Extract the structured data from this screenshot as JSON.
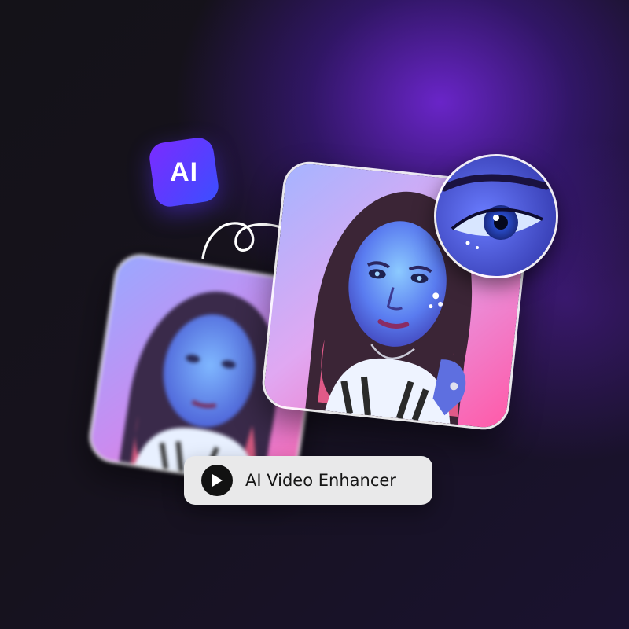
{
  "badge": {
    "text": "AI"
  },
  "cta": {
    "label": "AI Video Enhancer",
    "icon": "play-icon"
  },
  "colors": {
    "badge_gradient_start": "#7a2cff",
    "badge_gradient_end": "#3b4fff",
    "background_dark": "#141218",
    "glow_purple": "#7828e6",
    "pill_background": "#e9e9ea",
    "play_button": "#121212"
  },
  "images": {
    "before": "blurred-portrait-image",
    "after": "enhanced-portrait-image",
    "zoom": "eye-closeup-image"
  }
}
